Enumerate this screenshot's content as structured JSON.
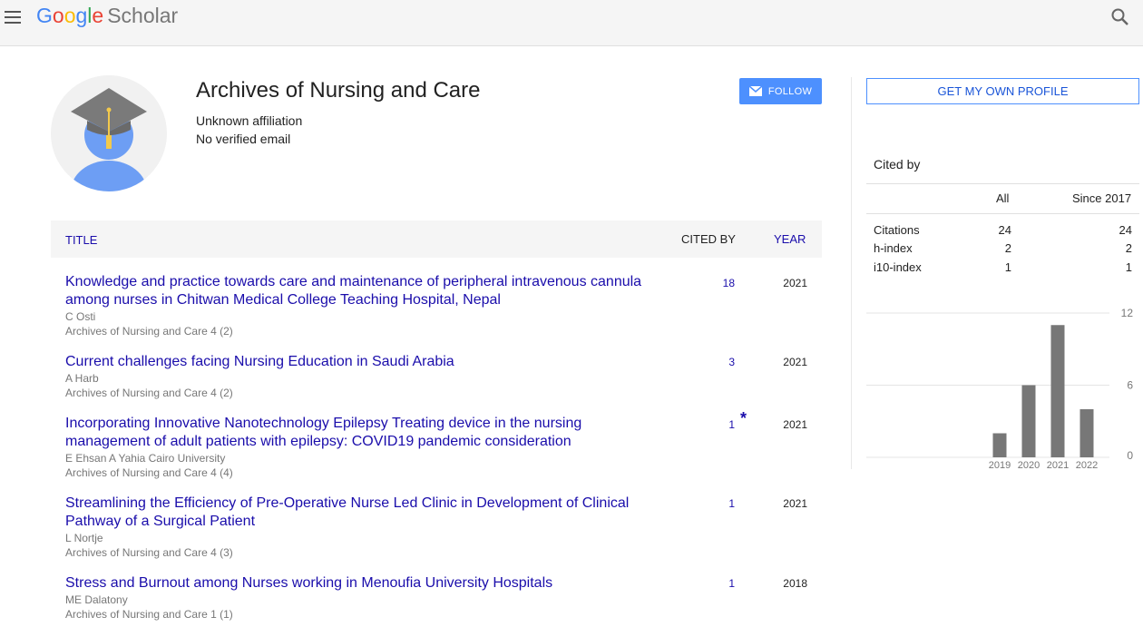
{
  "header": {
    "logo_google": [
      "G",
      "o",
      "o",
      "g",
      "l",
      "e"
    ],
    "logo_scholar": "Scholar"
  },
  "profile": {
    "name": "Archives of Nursing and Care",
    "affiliation": "Unknown affiliation",
    "email": "No verified email",
    "follow_label": "FOLLOW",
    "get_profile_label": "GET MY OWN PROFILE"
  },
  "table": {
    "col_title": "TITLE",
    "col_cited": "CITED BY",
    "col_year": "YEAR",
    "rows": [
      {
        "title": "Knowledge and practice towards care and maintenance of peripheral intravenous cannula among nurses in Chitwan Medical College Teaching Hospital, Nepal",
        "authors": "C Osti",
        "venue": "Archives of Nursing and Care 4 (2)",
        "cited": "18",
        "year": "2021",
        "star": ""
      },
      {
        "title": "Current challenges facing Nursing Education in Saudi Arabia",
        "authors": "A Harb",
        "venue": "Archives of Nursing and Care 4 (2)",
        "cited": "3",
        "year": "2021",
        "star": ""
      },
      {
        "title": "Incorporating Innovative Nanotechnology Epilepsy Treating device in the nursing management of adult patients with epilepsy: COVID19 pandemic consideration",
        "authors": "E Ehsan A Yahia Cairo University",
        "venue": "Archives of Nursing and Care 4 (4)",
        "cited": "1",
        "year": "2021",
        "star": "*"
      },
      {
        "title": "Streamlining the Efficiency of Pre-Operative Nurse Led Clinic in Development of Clinical Pathway of a Surgical Patient",
        "authors": "L Nortje",
        "venue": "Archives of Nursing and Care 4 (3)",
        "cited": "1",
        "year": "2021",
        "star": ""
      },
      {
        "title": "Stress and Burnout among Nurses working in Menoufia University Hospitals",
        "authors": "ME Dalatony",
        "venue": "Archives of Nursing and Care 1 (1)",
        "cited": "1",
        "year": "2018",
        "star": ""
      }
    ]
  },
  "cited_by": {
    "title": "Cited by",
    "col_all": "All",
    "col_since": "Since 2017",
    "rows": [
      {
        "label": "Citations",
        "all": "24",
        "since": "24"
      },
      {
        "label": "h-index",
        "all": "2",
        "since": "2"
      },
      {
        "label": "i10-index",
        "all": "1",
        "since": "1"
      }
    ]
  },
  "chart_data": {
    "type": "bar",
    "categories": [
      "2019",
      "2020",
      "2021",
      "2022"
    ],
    "values": [
      2,
      6,
      11,
      4
    ],
    "yticks": [
      "12",
      "6",
      "0"
    ],
    "ylim": [
      0,
      12
    ],
    "bar_color": "#777777",
    "grid": true
  }
}
